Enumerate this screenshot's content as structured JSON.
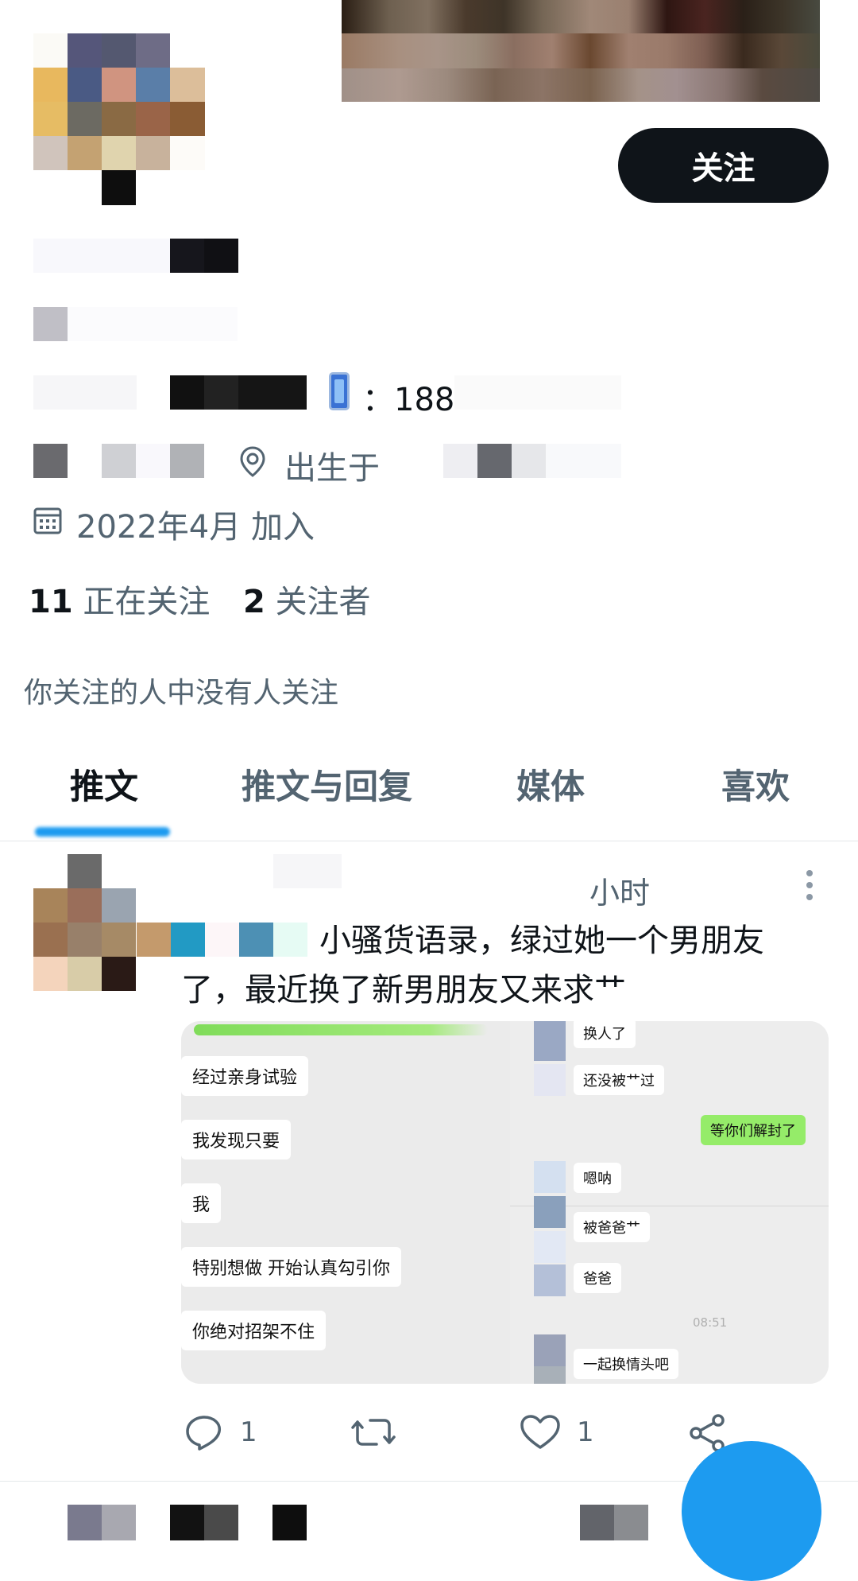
{
  "profile": {
    "follow_label": "关注",
    "phone_prefix": "：188",
    "born_label": "出生于",
    "joined": "2022年4月 加入",
    "following_count": "11",
    "following_label": "正在关注",
    "followers_count": "2",
    "followers_label": "关注者",
    "mutual_note": "你关注的人中没有人关注"
  },
  "tabs": [
    {
      "label": "推文"
    },
    {
      "label": "推文与回复"
    },
    {
      "label": "媒体"
    },
    {
      "label": "喜欢"
    }
  ],
  "tweet": {
    "time": "小时",
    "text_line1": "小骚货语录，绿过她一个男朋友",
    "text_line2": "了，最近换了新男朋友又来求艹",
    "image": {
      "left_messages": [
        "经过亲身试验",
        "我发现只要",
        "我",
        "特别想做 开始认真勾引你",
        "你绝对招架不住"
      ],
      "right_messages": [
        "换人了",
        "还没被艹过",
        "嗯呐",
        "被爸爸艹",
        "爸爸",
        "一起换情头吧"
      ],
      "right_sent": "等你们解封了",
      "timestamp": "08:51"
    },
    "reply_count": "1",
    "like_count": "1"
  },
  "icons": [
    "phone-icon",
    "location-icon",
    "calendar-icon",
    "more-icon",
    "reply-icon",
    "retweet-icon",
    "like-icon",
    "share-icon"
  ],
  "colors": {
    "accent": "#1d9bf0",
    "text": "#0f1419",
    "secondary": "#536471",
    "wechat_green": "#95ec69"
  }
}
